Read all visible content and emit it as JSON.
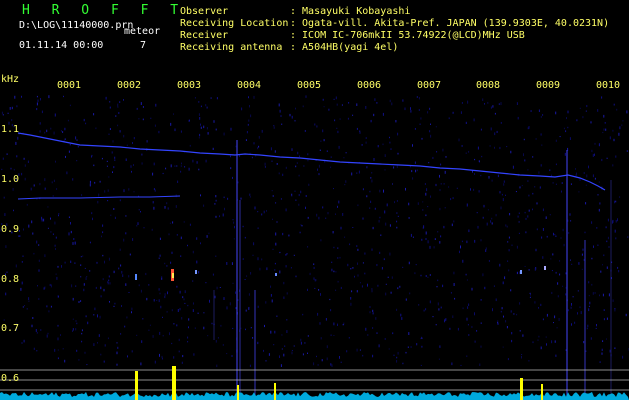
{
  "app": {
    "title": "H R O F F T"
  },
  "file": {
    "path": "D:\\LOG\\11140000.prn",
    "mode": "meteor",
    "datetime": "01.11.14 00:00",
    "count": "7"
  },
  "station": [
    {
      "key": "Observer",
      "value": ": Masayuki Kobayashi"
    },
    {
      "key": "Receiving Location",
      "value": ": Ogata-vill. Akita-Pref. JAPAN (139.9303E, 40.0231N)"
    },
    {
      "key": "Receiver",
      "value": ": ICOM IC-706mkII 53.74922(@LCD)MHz USB"
    },
    {
      "key": "Receiving antenna",
      "value": ": A504HB(yagi 4el)"
    }
  ],
  "axis": {
    "y_unit": "kHz",
    "y_ticks": [
      "1.1",
      "1.0",
      "0.9",
      "0.8",
      "0.7",
      "0.6"
    ],
    "x_ticks": [
      "0001",
      "0002",
      "0003",
      "0004",
      "0005",
      "0006",
      "0007",
      "0008",
      "0009",
      "0010"
    ]
  },
  "colors": {
    "header": "#ffff66",
    "title": "#33ff33",
    "trace": "#3344ff",
    "baseline": "#00ccff",
    "echo": "#ffff00"
  }
}
